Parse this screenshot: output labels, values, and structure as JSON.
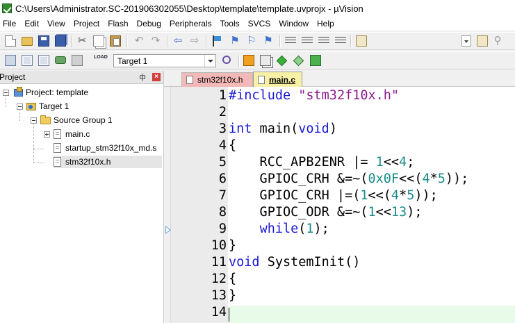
{
  "window": {
    "title": "C:\\Users\\Administrator.SC-201906302055\\Desktop\\template\\template.uvprojx - µVision",
    "app_icon": "uvision-app-icon"
  },
  "menu": [
    "File",
    "Edit",
    "View",
    "Project",
    "Flash",
    "Debug",
    "Peripherals",
    "Tools",
    "SVCS",
    "Window",
    "Help"
  ],
  "toolbar2": {
    "target_value": "Target 1",
    "load_label": "LOAD"
  },
  "project_panel": {
    "title": "Project",
    "pin": "ф",
    "close": "×",
    "tree": {
      "project_label": "Project: template",
      "target_label": "Target 1",
      "group_label": "Source Group 1",
      "files": [
        "main.c",
        "startup_stm32f10x_md.s",
        "stm32f10x.h"
      ],
      "selected_file": "stm32f10x.h"
    }
  },
  "editor": {
    "tabs": [
      {
        "label": "stm32f10x.h",
        "active": false,
        "color": "#f3b8b8"
      },
      {
        "label": "main.c",
        "active": true,
        "color": "#f7f1a8"
      }
    ],
    "current_line": 14,
    "lines": [
      {
        "n": "1",
        "tokens": [
          {
            "t": "#include ",
            "c": "pp"
          },
          {
            "t": "\"stm32f10x.h\"",
            "c": "str"
          }
        ]
      },
      {
        "n": "2",
        "tokens": []
      },
      {
        "n": "3",
        "tokens": [
          {
            "t": "int",
            "c": "kw"
          },
          {
            "t": " main(",
            "c": "op"
          },
          {
            "t": "void",
            "c": "kw"
          },
          {
            "t": ")",
            "c": "op"
          }
        ]
      },
      {
        "n": "4",
        "tokens": [
          {
            "t": "{",
            "c": "op"
          }
        ]
      },
      {
        "n": "5",
        "tokens": [
          {
            "t": "    RCC_APB2ENR |= ",
            "c": "op"
          },
          {
            "t": "1",
            "c": "num"
          },
          {
            "t": "<<",
            "c": "op"
          },
          {
            "t": "4",
            "c": "num"
          },
          {
            "t": ";",
            "c": "op"
          }
        ]
      },
      {
        "n": "6",
        "tokens": [
          {
            "t": "    GPIOC_CRH &=~(",
            "c": "op"
          },
          {
            "t": "0x0F",
            "c": "num"
          },
          {
            "t": "<<(",
            "c": "op"
          },
          {
            "t": "4",
            "c": "num"
          },
          {
            "t": "*",
            "c": "op"
          },
          {
            "t": "5",
            "c": "num"
          },
          {
            "t": "));",
            "c": "op"
          }
        ]
      },
      {
        "n": "7",
        "tokens": [
          {
            "t": "    GPIOC_CRH |=(",
            "c": "op"
          },
          {
            "t": "1",
            "c": "num"
          },
          {
            "t": "<<(",
            "c": "op"
          },
          {
            "t": "4",
            "c": "num"
          },
          {
            "t": "*",
            "c": "op"
          },
          {
            "t": "5",
            "c": "num"
          },
          {
            "t": "));",
            "c": "op"
          }
        ]
      },
      {
        "n": "8",
        "tokens": [
          {
            "t": "    GPIOC_ODR &=~(",
            "c": "op"
          },
          {
            "t": "1",
            "c": "num"
          },
          {
            "t": "<<",
            "c": "op"
          },
          {
            "t": "13",
            "c": "num"
          },
          {
            "t": ");",
            "c": "op"
          }
        ]
      },
      {
        "n": "9",
        "tokens": [
          {
            "t": "    ",
            "c": "op"
          },
          {
            "t": "while",
            "c": "kw"
          },
          {
            "t": "(",
            "c": "op"
          },
          {
            "t": "1",
            "c": "num"
          },
          {
            "t": ");",
            "c": "op"
          }
        ]
      },
      {
        "n": "10",
        "tokens": [
          {
            "t": "}",
            "c": "op"
          }
        ]
      },
      {
        "n": "11",
        "tokens": [
          {
            "t": "void",
            "c": "kw"
          },
          {
            "t": " SystemInit()",
            "c": "op"
          }
        ]
      },
      {
        "n": "12",
        "tokens": [
          {
            "t": "{",
            "c": "op"
          }
        ]
      },
      {
        "n": "13",
        "tokens": [
          {
            "t": "}",
            "c": "op"
          }
        ]
      },
      {
        "n": "14",
        "tokens": []
      }
    ]
  }
}
